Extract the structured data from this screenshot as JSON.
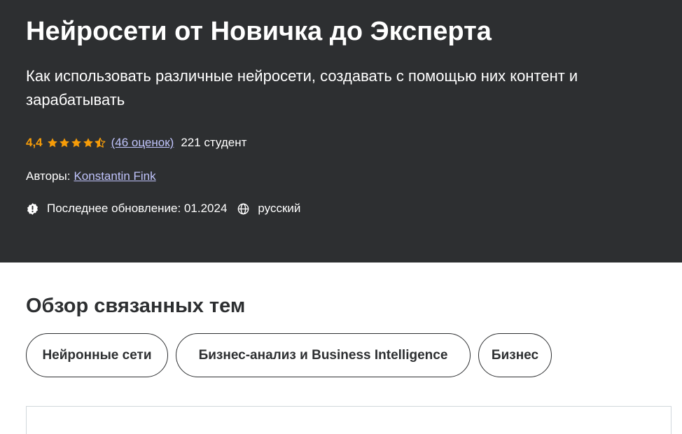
{
  "course": {
    "title": "Нейросети от Новичка до Эксперта",
    "subtitle": "Как использовать различные нейросети, создавать с помощью них контент и зарабатывать",
    "rating_value": "4,4",
    "rating_stars": 4.5,
    "rating_count": "(46 оценок)",
    "students": "221 студент",
    "authors_label": "Авторы:",
    "author_name": "Konstantin Fink",
    "last_updated": "Последнее обновление: 01.2024",
    "language": "русский"
  },
  "icons": {
    "star": "star-icon",
    "update": "alert-badge-icon",
    "language": "globe-icon"
  },
  "related": {
    "heading": "Обзор связанных тем",
    "topics": [
      "Нейронные сети",
      "Бизнес-анализ и Business Intelligence",
      "Бизнес"
    ]
  },
  "colors": {
    "hero_background": "#2d2f31",
    "rating_orange": "#f69c08",
    "link_lavender": "#c0c4fc",
    "text_dark": "#2d2f31",
    "border_light": "#d1d7dc"
  }
}
